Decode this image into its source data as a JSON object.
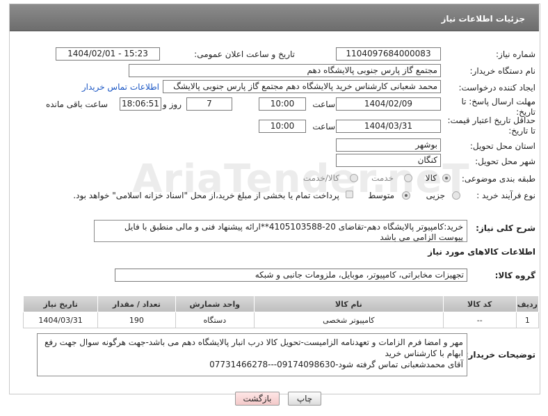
{
  "header": {
    "title": "جزئیات اطلاعات نیاز"
  },
  "form": {
    "need_number_label": "شماره نیاز:",
    "need_number": "1104097684000083",
    "announce_label": "تاریخ و ساعت اعلان عمومی:",
    "announce_value": "1404/02/01 - 15:23",
    "buyer_org_label": "نام دستگاه خریدار:",
    "buyer_org": "مجتمع گاز پارس جنوبی  پالایشگاه دهم",
    "creator_label": "ایجاد کننده درخواست:",
    "creator": "محمد شعبانی کارشناس خرید پالایشگاه دهم  مجتمع گاز پارس جنوبی  پالایشگ",
    "contact_link": "اطلاعات تماس خریدار",
    "deadline_label": "مهلت ارسال پاسخ: تا تاریخ:",
    "deadline_date": "1404/02/09",
    "time_label": "ساعت",
    "deadline_time": "10:00",
    "days_value": "7",
    "days_label": "روز و",
    "remaining_time": "18:06:51",
    "remaining_label": "ساعت باقی مانده",
    "min_validity_label": "حداقل تاریخ اعتبار قیمت: تا تاریخ:",
    "validity_date": "1404/03/31",
    "validity_time": "10:00",
    "province_label": "استان محل تحویل:",
    "province": "بوشهر",
    "city_label": "شهر محل تحویل:",
    "city": "کنگان",
    "category_label": "طبقه بندی موضوعی:",
    "category_options": [
      "کالا",
      "خدمت",
      "کالا/خدمت"
    ],
    "process_label": "نوع فرآیند خرید :",
    "process_options": [
      "جزیی",
      "متوسط"
    ],
    "payment_note": "پرداخت تمام یا بخشی از مبلغ خرید،از محل \"اسناد خزانه اسلامی\" خواهد بود.",
    "general_desc_label": "شرح کلی نیاز:",
    "general_desc": "خرید:کامپیوتر پالایشگاه دهم-تقاضای 20-4105103588**ارائه پیشنهاد فنی و مالی منطبق با فایل پیوست الزامی می باشد"
  },
  "goods": {
    "section_title": "اطلاعات کالاهای مورد نیاز",
    "group_label": "گروه کالا:",
    "group_value": "تجهیزات مخابراتی، کامپیوتر، موبایل، ملزومات جانبی و شبکه",
    "columns": [
      "ردیف",
      "کد کالا",
      "نام کالا",
      "واحد شمارش",
      "تعداد / مقدار",
      "تاریخ نیاز"
    ],
    "rows": [
      {
        "row": "1",
        "code": "--",
        "name": "کامپیوتر شخصی",
        "unit": "دستگاه",
        "qty": "190",
        "date": "1404/03/31"
      }
    ]
  },
  "buyer_notes": {
    "label": "توضیحات خریدار:",
    "line1": "مهر و امضا فرم الزامات و تعهدنامه الزامیست-تحویل کالا درب انبار پالایشگاه دهم می باشد-جهت هرگونه سوال جهت رفع",
    "line2": "ابهام با کارشناس خرید",
    "line3": "آقای محمدشعبانی تماس گرفته شود-09174098630---07731466278"
  },
  "buttons": {
    "print": "چاپ",
    "back": "بازگشت"
  },
  "watermark": "AriaTender.neT"
}
